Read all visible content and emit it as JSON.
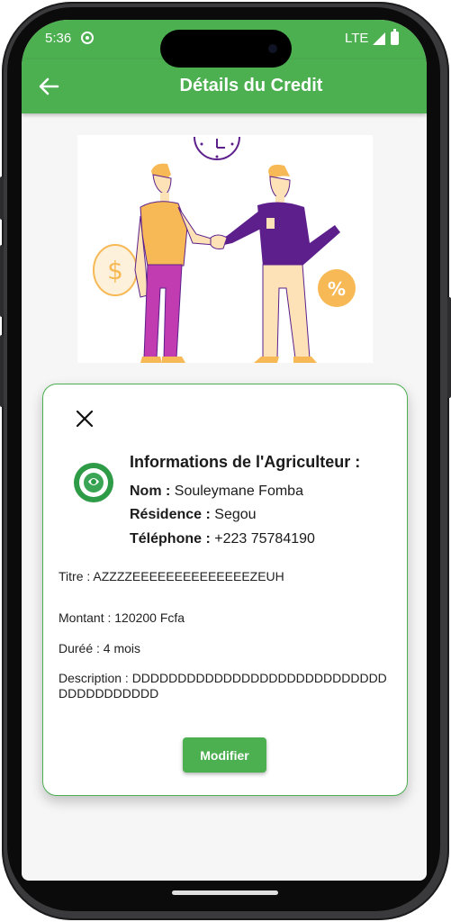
{
  "status_bar": {
    "time": "5:36",
    "network": "LTE"
  },
  "app_bar": {
    "title": "Détails du Credit",
    "back_icon": "arrow-left-icon"
  },
  "illustration": {
    "description_icon": "handshake-illustration",
    "dollar_symbol": "$",
    "percent_symbol": "%"
  },
  "card": {
    "close_icon": "close-icon",
    "logo_icon": "cooperative-logo-icon",
    "info_title": "Informations de l'Agriculteur :",
    "nom_label": "Nom :",
    "nom_value": "Souleymane Fomba",
    "residence_label": "Résidence :",
    "residence_value": "Segou",
    "telephone_label": "Téléphone :",
    "telephone_value": "+223 75784190",
    "titre": "Titre : AZZZZEEEEEEEEEEEEEEZEUH",
    "montant": "Montant : 120200 Fcfa",
    "duree": "Duréé : 4 mois",
    "description": "Description : DDDDDDDDDDDDDDDDDDDDDDDDDDDDDDDDDDDDDDD",
    "modify_label": "Modifier"
  },
  "colors": {
    "primary": "#4caf50",
    "illustration_orange": "#f7b955",
    "illustration_purple": "#5c1f8c",
    "illustration_magenta": "#c13bb1"
  }
}
